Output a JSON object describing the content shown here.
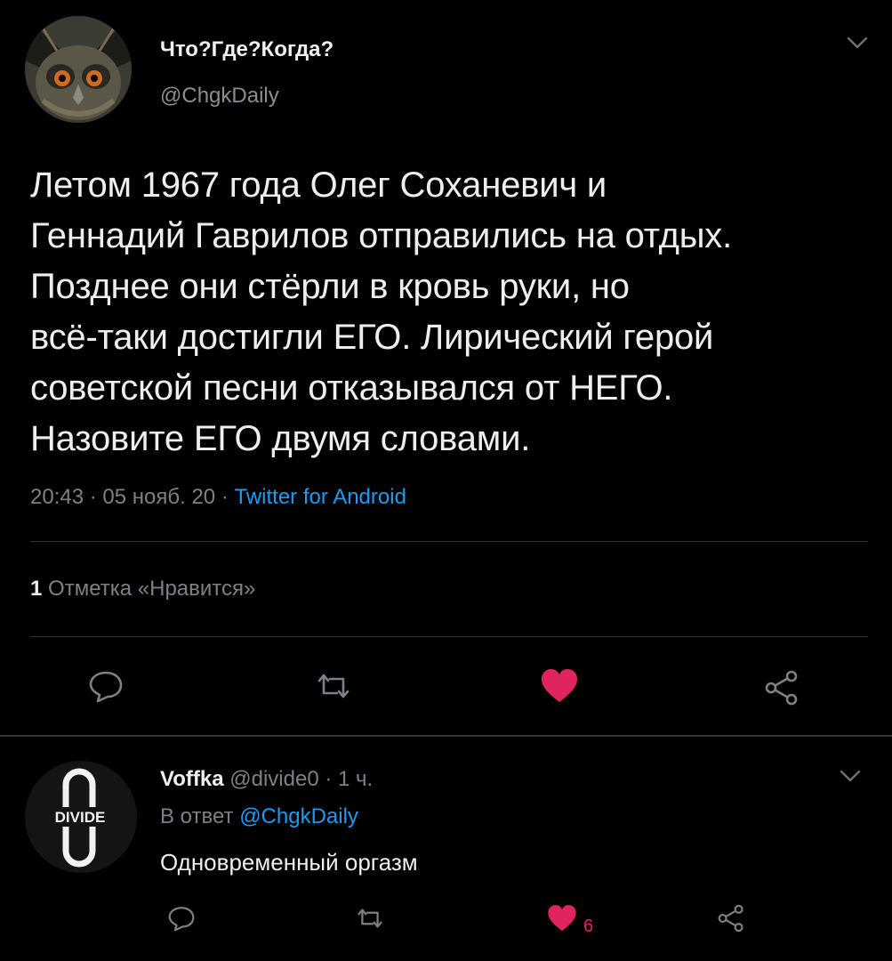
{
  "tweet": {
    "author_name": "Что?Где?Когда?",
    "author_handle": "@ChgkDaily",
    "text_lines": [
      "Летом 1967 года Олег Соханевич и",
      "Геннадий Гаврилов отправились на отдых.",
      "Позднее они стёрли в кровь руки, но",
      "всё-таки достигли ЕГО. Лирический герой",
      "советской песни отказывался от НЕГО.",
      "Назовите ЕГО двумя словами."
    ],
    "time": "20:43",
    "date": "05 нояб. 20",
    "source": "Twitter for Android",
    "likes_count": "1",
    "likes_label": "Отметка «Нравится»"
  },
  "reply": {
    "author_name": "Voffka",
    "author_handle": "@divide0",
    "time_ago": "1 ч.",
    "in_reply_prefix": "В ответ",
    "in_reply_mention": "@ChgkDaily",
    "text": "Одновременный оргазм",
    "avatar_text": "DIVIDE",
    "like_count": "6"
  },
  "icons": {
    "reply": "comment-icon",
    "retweet": "retweet-icon",
    "like": "heart-icon",
    "share": "share-icon",
    "menu": "chevron-down-icon"
  },
  "colors": {
    "background": "#000000",
    "link": "#1d9bf0",
    "like": "#e0245e",
    "muted": "#7d8186"
  }
}
